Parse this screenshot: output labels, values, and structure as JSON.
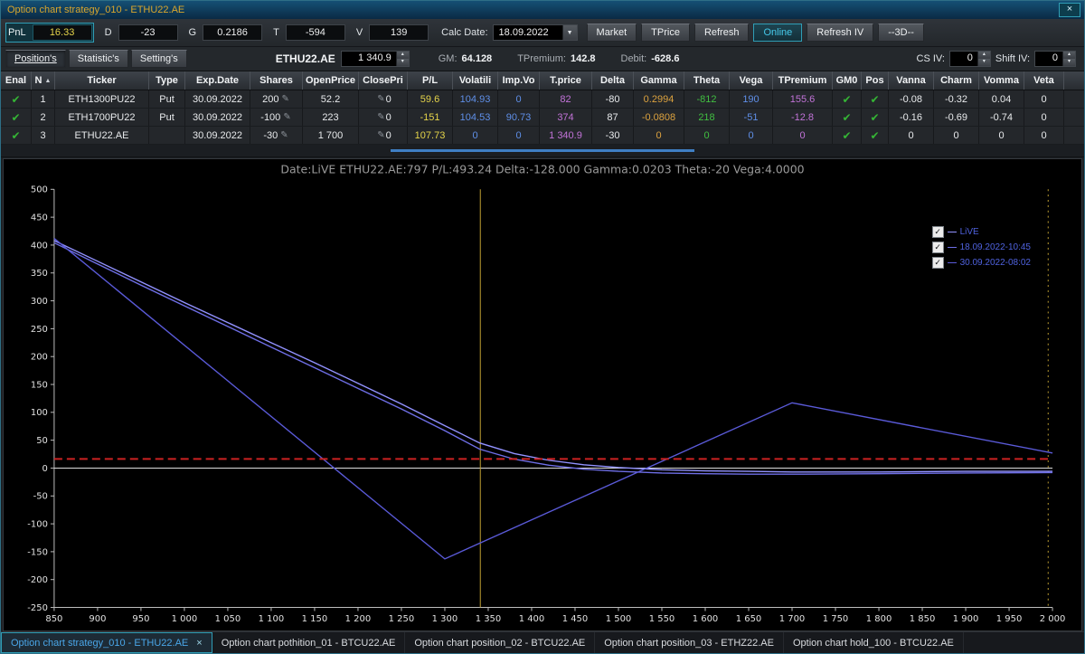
{
  "icons": {
    "close": "×",
    "dropdown": "▼",
    "spin_up": "▴",
    "spin_down": "▾",
    "check": "✔",
    "legend_check": "✓",
    "pencil": "✎",
    "sort_asc": "▲"
  },
  "colors": {
    "accent_teal": "#2f9db5",
    "title_gold": "#d9a62d",
    "value_yellow": "#e5d44a",
    "value_orange": "#dca23f",
    "value_blue": "#5f8fe8",
    "value_violet": "#c273d8",
    "value_green": "#41bf41",
    "check_green": "#35b535",
    "active_tab_blue": "#4aa6e8"
  },
  "titlebar": {
    "title": "Option chart strategy_010 - ETHU22.AE"
  },
  "toolbar": {
    "metrics": [
      {
        "label": "PnL",
        "value": "16.33",
        "highlight": true
      },
      {
        "label": "D",
        "value": "-23"
      },
      {
        "label": "G",
        "value": "0.2186"
      },
      {
        "label": "T",
        "value": "-594"
      },
      {
        "label": "V",
        "value": "139"
      }
    ],
    "calc_date_label": "Calc Date:",
    "calc_date_value": "18.09.2022",
    "buttons": [
      {
        "label": "Market"
      },
      {
        "label": "TPrice"
      },
      {
        "label": "Refresh"
      },
      {
        "label": "Online",
        "active": true
      },
      {
        "label": "Refresh IV"
      },
      {
        "label": "--3D--"
      }
    ]
  },
  "subbar": {
    "tabs": [
      {
        "label": "Position's",
        "active": true
      },
      {
        "label": "Statistic's"
      },
      {
        "label": "Setting's"
      }
    ],
    "symbol": "ETHU22.AE",
    "price_value": "1 340.9",
    "fields": [
      {
        "label": "GM:",
        "value": "64.128"
      },
      {
        "label": "TPremium:",
        "value": "142.8"
      },
      {
        "label": "Debit:",
        "value": "-628.6"
      }
    ],
    "cs_iv_label": "CS IV:",
    "cs_iv_value": "0",
    "shift_iv_label": "Shift IV:",
    "shift_iv_value": "0"
  },
  "table": {
    "columns": [
      "Enal",
      "N",
      "Ticker",
      "Type",
      "Exp.Date",
      "Shares",
      "OpenPrice",
      "ClosePri",
      "P/L",
      "Volatili",
      "Imp.Vo",
      "T.price",
      "Delta",
      "Gamma",
      "Theta",
      "Vega",
      "TPremium",
      "GM0",
      "Pos",
      "Vanna",
      "Charm",
      "Vomma",
      "Veta"
    ],
    "rows": [
      {
        "enal": "✔",
        "n": "1",
        "ticker": "ETH1300PU22",
        "type": "Put",
        "expdate": "30.09.2022",
        "shares": "200",
        "openprice": "52.2",
        "closeprice": "0",
        "pl": "59.6",
        "vol": "104.93",
        "impvo": "0",
        "tprice": "82",
        "delta": "-80",
        "gamma": "0.2994",
        "theta": "-812",
        "vega": "190",
        "tpremium": "155.6",
        "gm0": "✔",
        "pos": "✔",
        "vanna": "-0.08",
        "charm": "-0.32",
        "vomma": "0.04",
        "veta": "0"
      },
      {
        "enal": "✔",
        "n": "2",
        "ticker": "ETH1700PU22",
        "type": "Put",
        "expdate": "30.09.2022",
        "shares": "-100",
        "openprice": "223",
        "closeprice": "0",
        "pl": "-151",
        "vol": "104.53",
        "impvo": "90.73",
        "tprice": "374",
        "delta": "87",
        "gamma": "-0.0808",
        "theta": "218",
        "vega": "-51",
        "tpremium": "-12.8",
        "gm0": "✔",
        "pos": "✔",
        "vanna": "-0.16",
        "charm": "-0.69",
        "vomma": "-0.74",
        "veta": "0"
      },
      {
        "enal": "✔",
        "n": "3",
        "ticker": "ETHU22.AE",
        "type": "",
        "expdate": "30.09.2022",
        "shares": "-30",
        "openprice": "1 700",
        "closeprice": "0",
        "pl": "107.73",
        "vol": "0",
        "impvo": "0",
        "tprice": "1 340.9",
        "delta": "-30",
        "gamma": "0",
        "theta": "0",
        "vega": "0",
        "tpremium": "0",
        "gm0": "✔",
        "pos": "✔",
        "vanna": "0",
        "charm": "0",
        "vomma": "0",
        "veta": "0"
      }
    ]
  },
  "chart_data": {
    "type": "line",
    "title": "Date:LiVE  ETHU22.AE:797  P/L:493.24  Delta:-128.000  Gamma:0.0203  Theta:-20  Vega:4.0000",
    "xlim": [
      850,
      2000
    ],
    "ylim": [
      -250,
      500
    ],
    "x_tick_step": 50,
    "y_tick_step": 50,
    "grid": false,
    "legend_position": "top-right",
    "series": [
      {
        "name": "LiVE",
        "color": "#9292ff",
        "points": [
          [
            850,
            408
          ],
          [
            900,
            371
          ],
          [
            950,
            334
          ],
          [
            1000,
            297
          ],
          [
            1050,
            261
          ],
          [
            1100,
            225
          ],
          [
            1150,
            189
          ],
          [
            1200,
            152
          ],
          [
            1250,
            115
          ],
          [
            1300,
            76
          ],
          [
            1340,
            45
          ],
          [
            1380,
            26
          ],
          [
            1420,
            14
          ],
          [
            1460,
            6
          ],
          [
            1500,
            1
          ],
          [
            1550,
            -3
          ],
          [
            1600,
            -5
          ],
          [
            1650,
            -6
          ],
          [
            1700,
            -7
          ],
          [
            1800,
            -7
          ],
          [
            1900,
            -6
          ],
          [
            2000,
            -6
          ]
        ]
      },
      {
        "name": "18.09.2022-10:45",
        "color": "#6e6ee6",
        "points": [
          [
            850,
            404
          ],
          [
            900,
            366
          ],
          [
            950,
            328
          ],
          [
            1000,
            291
          ],
          [
            1050,
            254
          ],
          [
            1100,
            217
          ],
          [
            1150,
            180
          ],
          [
            1200,
            143
          ],
          [
            1250,
            106
          ],
          [
            1300,
            67
          ],
          [
            1340,
            34
          ],
          [
            1380,
            16
          ],
          [
            1420,
            5
          ],
          [
            1460,
            -2
          ],
          [
            1500,
            -6
          ],
          [
            1550,
            -9
          ],
          [
            1600,
            -10
          ],
          [
            1650,
            -11
          ],
          [
            1700,
            -11
          ],
          [
            1800,
            -10
          ],
          [
            1900,
            -9
          ],
          [
            2000,
            -8
          ]
        ]
      },
      {
        "name": "30.09.2022-08:02",
        "color": "#5a5ad8",
        "points": [
          [
            850,
            412
          ],
          [
            1300,
            -163
          ],
          [
            1700,
            117
          ],
          [
            2000,
            27
          ]
        ]
      }
    ],
    "markers": {
      "zero_line": {
        "y": 0,
        "color": "#dcdcdc"
      },
      "pnl_line": {
        "y": 16.33,
        "color": "#cc2222",
        "style": "dashed"
      },
      "price_line": {
        "x": 1340.9,
        "color": "#bfa032",
        "style": "solid"
      },
      "right_dotted_line": {
        "x": 1995,
        "color": "#bfa032",
        "style": "dotted"
      }
    },
    "legend": [
      {
        "label": "LiVE",
        "checked": true
      },
      {
        "label": "18.09.2022-10:45",
        "checked": true
      },
      {
        "label": "30.09.2022-08:02",
        "checked": true
      }
    ]
  },
  "bottom_tabs": [
    {
      "label": "Option chart strategy_010 - ETHU22.AE",
      "active": true,
      "closable": true
    },
    {
      "label": "Option chart pothition_01 - BTCU22.AE"
    },
    {
      "label": "Option chart position_02 - BTCU22.AE"
    },
    {
      "label": "Option chart position_03 - ETHZ22.AE"
    },
    {
      "label": "Option chart hold_100 - BTCU22.AE"
    }
  ]
}
